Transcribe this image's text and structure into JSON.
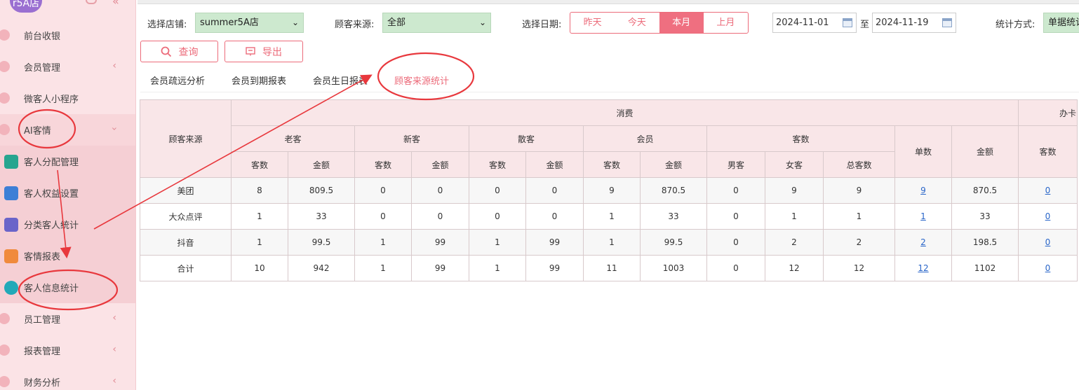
{
  "sidebar": {
    "store_name": "r5A店",
    "items": [
      {
        "label": "前台收银",
        "icon": "cash-icon",
        "has_chevron": false
      },
      {
        "label": "会员管理",
        "icon": "member-icon",
        "has_chevron": true
      },
      {
        "label": "微客人小程序",
        "icon": "miniapp-icon",
        "has_chevron": false
      },
      {
        "label": "AI客情",
        "icon": "ai-icon",
        "has_chevron": true
      }
    ],
    "sub_items": [
      {
        "label": "客人分配管理",
        "icon": "person-icon",
        "color": "#27a58f"
      },
      {
        "label": "客人权益设置",
        "icon": "gear-icon",
        "color": "#3d7fd6"
      },
      {
        "label": "分类客人统计",
        "icon": "group-icon",
        "color": "#6a64c9"
      },
      {
        "label": "客情报表",
        "icon": "bar-chart-icon",
        "color": "#f08a3c"
      },
      {
        "label": "客人信息统计",
        "icon": "pie-chart-icon",
        "color": "#22a9b8"
      }
    ],
    "bottom_items": [
      {
        "label": "员工管理",
        "icon": "staff-icon"
      },
      {
        "label": "报表管理",
        "icon": "report-icon"
      },
      {
        "label": "财务分析",
        "icon": "finance-icon"
      }
    ]
  },
  "filters": {
    "store_label": "选择店铺:",
    "store_value": "summer5A店",
    "source_label": "顾客来源:",
    "source_value": "全部",
    "date_label": "选择日期:",
    "date_buttons": [
      "昨天",
      "今天",
      "本月",
      "上月"
    ],
    "date_active": "本月",
    "date_from": "2024-11-01",
    "date_to_label": "至",
    "date_to": "2024-11-19",
    "stat_label": "统计方式:",
    "stat_value": "单据统计"
  },
  "actions": {
    "query_label": "查询",
    "export_label": "导出"
  },
  "tabs": [
    "会员疏远分析",
    "会员到期报表",
    "会员生日报表",
    "顾客来源统计"
  ],
  "active_tab": "顾客来源统计",
  "table": {
    "source_header": "顾客来源",
    "group_consume": "消费",
    "group_card": "办卡",
    "sub_old": "老客",
    "sub_new": "新客",
    "sub_walkin": "散客",
    "sub_member": "会员",
    "sub_guests": "客数",
    "col_guests": "客数",
    "col_amount": "金额",
    "col_male": "男客",
    "col_female": "女客",
    "col_total": "总客数",
    "col_orders": "单数",
    "rows": [
      {
        "source": "美团",
        "old_n": "8",
        "old_amt": "809.5",
        "new_n": "0",
        "new_amt": "0",
        "walk_n": "0",
        "walk_amt": "0",
        "mem_n": "9",
        "mem_amt": "870.5",
        "male": "0",
        "female": "9",
        "total": "9",
        "orders": "9",
        "amount": "870.5",
        "card_n": "0"
      },
      {
        "source": "大众点评",
        "old_n": "1",
        "old_amt": "33",
        "new_n": "0",
        "new_amt": "0",
        "walk_n": "0",
        "walk_amt": "0",
        "mem_n": "1",
        "mem_amt": "33",
        "male": "0",
        "female": "1",
        "total": "1",
        "orders": "1",
        "amount": "33",
        "card_n": "0"
      },
      {
        "source": "抖音",
        "old_n": "1",
        "old_amt": "99.5",
        "new_n": "1",
        "new_amt": "99",
        "walk_n": "1",
        "walk_amt": "99",
        "mem_n": "1",
        "mem_amt": "99.5",
        "male": "0",
        "female": "2",
        "total": "2",
        "orders": "2",
        "amount": "198.5",
        "card_n": "0"
      },
      {
        "source": "合计",
        "old_n": "10",
        "old_amt": "942",
        "new_n": "1",
        "new_amt": "99",
        "walk_n": "1",
        "walk_amt": "99",
        "mem_n": "11",
        "mem_amt": "1003",
        "male": "0",
        "female": "12",
        "total": "12",
        "orders": "12",
        "amount": "1102",
        "card_n": "0"
      }
    ]
  },
  "colors": {
    "accent": "#ec6b7a",
    "sidebar_bg": "#fbe3e6",
    "annotation": "#e8383d",
    "link": "#2a66c9"
  }
}
